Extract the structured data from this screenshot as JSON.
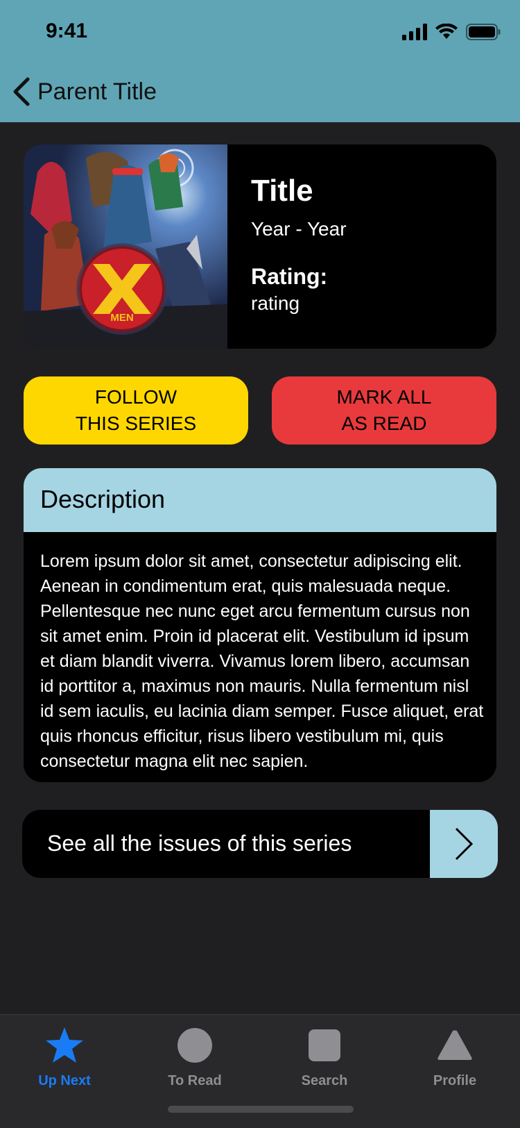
{
  "status_bar": {
    "time": "9:41"
  },
  "nav": {
    "back_label": "Parent Title"
  },
  "series": {
    "title": "Title",
    "years": "Year - Year",
    "rating_label": "Rating:",
    "rating_value": "rating",
    "cover_logo_text": "MEN"
  },
  "actions": {
    "follow_label": "FOLLOW\nTHIS SERIES",
    "mark_read_label": "MARK ALL\nAS READ"
  },
  "description": {
    "title": "Description",
    "body": "Lorem ipsum dolor sit amet, consectetur adipiscing elit. Aenean in condimentum erat, quis malesuada neque. Pellentesque nec nunc eget arcu fermentum cursus non sit amet enim. Proin id placerat elit. Vestibulum id ipsum et diam blandit viverra. Vivamus lorem libero, accumsan id porttitor a, maximus non mauris. Nulla fermentum nisl id sem iaculis, eu lacinia diam semper. Fusce aliquet, erat quis rhoncus efficitur, risus libero vestibulum mi, quis consectetur magna elit nec sapien."
  },
  "issues_link": {
    "label": "See all the issues of this series"
  },
  "tabbar": {
    "tabs": [
      {
        "label": "Up Next",
        "icon": "star-icon",
        "active": true
      },
      {
        "label": "To Read",
        "icon": "circle-icon",
        "active": false
      },
      {
        "label": "Search",
        "icon": "square-icon",
        "active": false
      },
      {
        "label": "Profile",
        "icon": "triangle-icon",
        "active": false
      }
    ]
  },
  "colors": {
    "header": "#5fa5b5",
    "background": "#1f1f21",
    "follow": "#fed700",
    "mark_read": "#e83a3c",
    "accent_light_blue": "#a5d4e2",
    "tab_active": "#1a7cf5",
    "tab_inactive": "#8e8e93"
  }
}
